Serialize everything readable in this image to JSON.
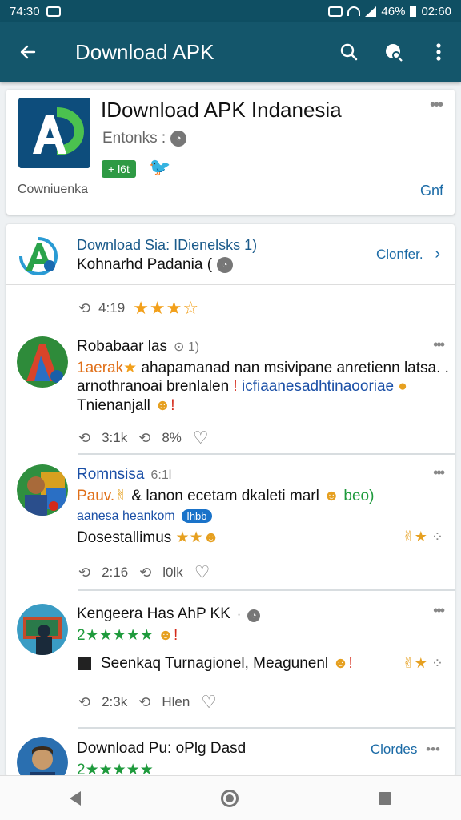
{
  "status": {
    "time": "74:30",
    "battery": "46%",
    "clock": "02:60"
  },
  "appbar": {
    "title": "Download APK"
  },
  "app_card": {
    "title": "IDownload APK Indanesia",
    "developer": "Entonks :",
    "install_chip": "+ l6t",
    "footer_left": "Cowniuenka",
    "footer_right": "Gnf"
  },
  "feed_header": {
    "title": "Download Sia: IDienelsks 1)",
    "subtitle": "Kohnarhd Padania (",
    "link": "Clonfer.",
    "stat_repost": "4:19",
    "rating_stars": 3,
    "rating_max": 4
  },
  "posts": [
    {
      "name": "Robabaar las",
      "meta": "⊙ 1)",
      "line1_prefix": "1aerak",
      "line1_rest": "ahapamanad nan msivipane anretienn latsa. .",
      "line2_a": "arnothranoai brenlalen",
      "line2_b": "icfiaanesadhtinaooriae",
      "line3": "Tnienanjall",
      "stat_a": "3:1k",
      "stat_b": "8%"
    },
    {
      "name": "Romnsisa",
      "meta": "6:1l",
      "line1_a": "Pauv.",
      "line1_b": "& lanon ecetam dkaleti marl",
      "line1_c": "beo)",
      "line2": "aanesa heankom",
      "line2_chip": "Ihbb",
      "line3": "Dosestallimus",
      "stat_a": "2:16",
      "stat_b": "l0lk"
    },
    {
      "name": "Kengeera Has AhP KK",
      "meta": "·",
      "rating_text": "2★★★★★",
      "line2": "Seenkaq Turnagionel, Meagunenl",
      "stat_a": "2:3k",
      "stat_b": "Hlen"
    },
    {
      "name": "Download Pu: oPlg Dasd",
      "rating_text": "2★★★★★",
      "link": "Clordes"
    }
  ]
}
